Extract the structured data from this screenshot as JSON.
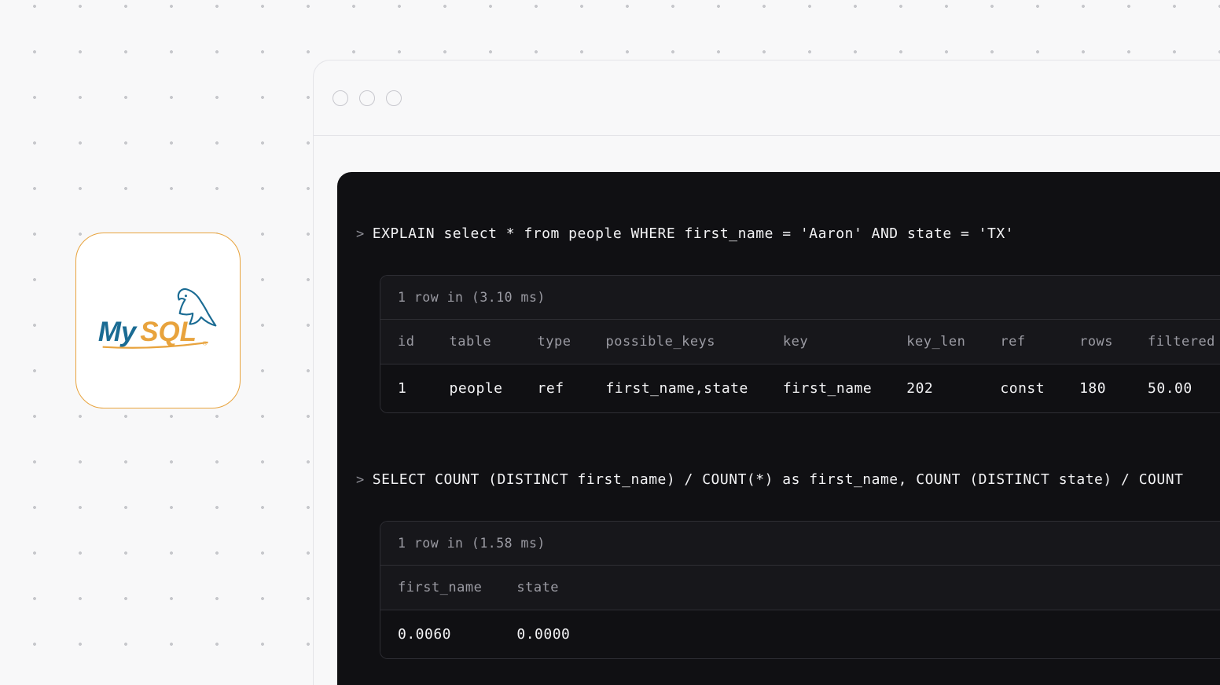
{
  "logo": {
    "name": "MySQL"
  },
  "terminal": {
    "queries": [
      {
        "prompt": ">",
        "sql": "EXPLAIN select * from people WHERE first_name = 'Aaron' AND state = 'TX'",
        "result": {
          "meta": "1 row in (3.10 ms)",
          "columns": [
            "id",
            "table",
            "type",
            "possible_keys",
            "key",
            "key_len",
            "ref",
            "rows",
            "filtered"
          ],
          "rows": [
            [
              "1",
              "people",
              "ref",
              "first_name,state",
              "first_name",
              "202",
              "const",
              "180",
              "50.00"
            ]
          ]
        }
      },
      {
        "prompt": ">",
        "sql": "SELECT COUNT (DISTINCT first_name) / COUNT(*) as first_name, COUNT (DISTINCT state) / COUNT",
        "result": {
          "meta": "1 row in (1.58 ms)",
          "columns": [
            "first_name",
            "state"
          ],
          "rows": [
            [
              "0.0060",
              "0.0000"
            ]
          ]
        }
      }
    ]
  }
}
